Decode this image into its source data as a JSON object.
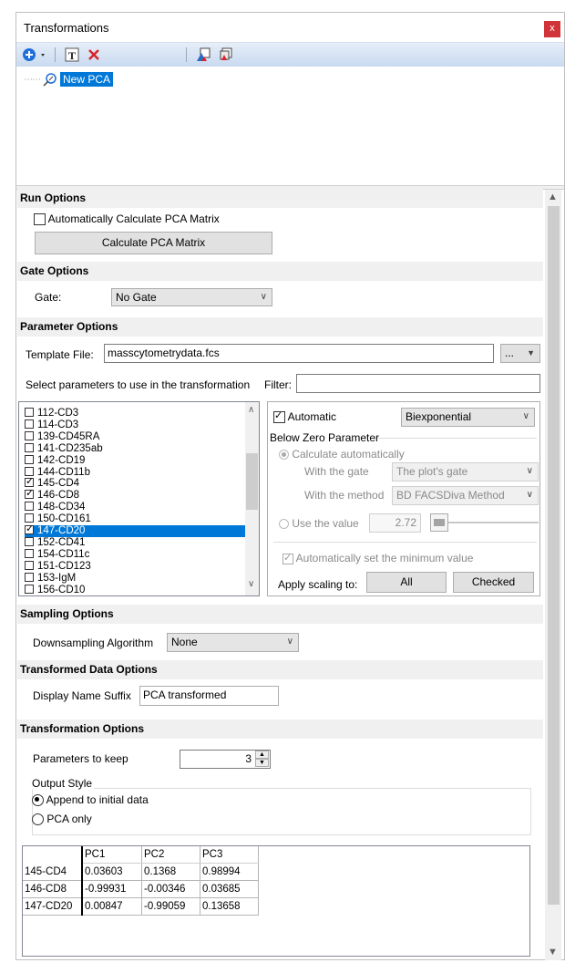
{
  "window": {
    "title": "Transformations",
    "close_glyph": "x"
  },
  "tree": {
    "node_label": "New PCA"
  },
  "run_options": {
    "header": "Run Options",
    "auto_calc_label": "Automatically Calculate PCA Matrix",
    "auto_calc_checked": false,
    "calc_button": "Calculate PCA Matrix"
  },
  "gate_options": {
    "header": "Gate Options",
    "gate_label": "Gate:",
    "gate_value": "No Gate"
  },
  "parameter_options": {
    "header": "Parameter Options",
    "template_label": "Template File:",
    "template_value": "masscytometrydata.fcs",
    "browse_label": "...",
    "select_label": "Select parameters to use in the transformation",
    "filter_label": "Filter:",
    "filter_value": "",
    "parameters": [
      {
        "name": "112-CD3",
        "checked": false
      },
      {
        "name": "114-CD3",
        "checked": false
      },
      {
        "name": "139-CD45RA",
        "checked": false
      },
      {
        "name": "141-CD235ab",
        "checked": false
      },
      {
        "name": "142-CD19",
        "checked": false
      },
      {
        "name": "144-CD11b",
        "checked": false
      },
      {
        "name": "145-CD4",
        "checked": true
      },
      {
        "name": "146-CD8",
        "checked": true
      },
      {
        "name": "148-CD34",
        "checked": false
      },
      {
        "name": "150-CD161",
        "checked": false
      },
      {
        "name": "147-CD20",
        "checked": true,
        "selected": true
      },
      {
        "name": "152-CD41",
        "checked": false
      },
      {
        "name": "154-CD11c",
        "checked": false
      },
      {
        "name": "151-CD123",
        "checked": false
      },
      {
        "name": "153-IgM",
        "checked": false
      },
      {
        "name": "156-CD10",
        "checked": false
      }
    ],
    "scaling": {
      "automatic_label": "Automatic",
      "automatic_checked": true,
      "scale_type": "Biexponential",
      "below_zero_label": "Below Zero Parameter",
      "calc_auto_label": "Calculate automatically",
      "with_gate_label": "With the gate",
      "with_gate_value": "The plot's gate",
      "with_method_label": "With the method",
      "with_method_value": "BD FACSDiva Method",
      "use_value_label": "Use the value",
      "use_value": "2.72",
      "auto_min_label": "Automatically set the minimum value",
      "apply_label": "Apply scaling to:",
      "all_button": "All",
      "checked_button": "Checked"
    }
  },
  "sampling_options": {
    "header": "Sampling Options",
    "algorithm_label": "Downsampling Algorithm",
    "algorithm_value": "None"
  },
  "transformed_data_options": {
    "header": "Transformed Data Options",
    "suffix_label": "Display Name Suffix",
    "suffix_value": "PCA transformed"
  },
  "transformation_options": {
    "header": "Transformation Options",
    "keep_label": "Parameters to keep",
    "keep_value": "3",
    "output_style_label": "Output Style",
    "append_label": "Append to initial data",
    "pca_only_label": "PCA only",
    "output_style": "append"
  },
  "pca_table": {
    "columns": [
      "PC1",
      "PC2",
      "PC3"
    ],
    "rows": [
      {
        "name": "145-CD4",
        "values": [
          "0.03603",
          "0.1368",
          "0.98994"
        ]
      },
      {
        "name": "146-CD8",
        "values": [
          "-0.99931",
          "-0.00346",
          "0.03685"
        ]
      },
      {
        "name": "147-CD20",
        "values": [
          "0.00847",
          "-0.99059",
          "0.13658"
        ]
      }
    ]
  },
  "colors": {
    "accent": "#0078d7",
    "toolbar": "#c9daf0",
    "section": "#f0f0f0",
    "close": "#d13438"
  }
}
